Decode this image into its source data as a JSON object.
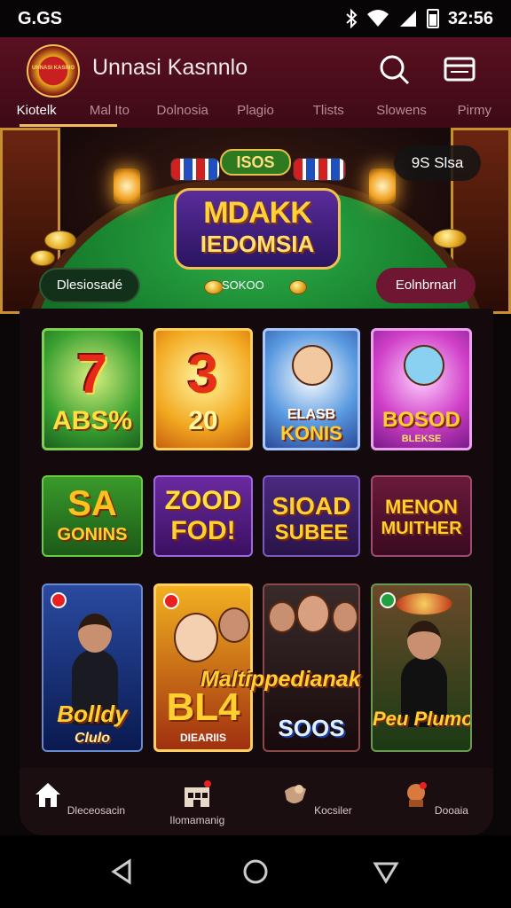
{
  "status": {
    "left": "G.GS",
    "time": "32:56"
  },
  "header": {
    "logo_text": "UNNASI KASINO",
    "title": "Unnasi Kasnnlo",
    "tabs": [
      {
        "label": "Kiotelk"
      },
      {
        "label": "Mal Ito"
      },
      {
        "label": "Dolnosia"
      },
      {
        "label": "Plagio"
      },
      {
        "label": "Tlists"
      },
      {
        "label": "Slowens"
      },
      {
        "label": "Pirmy"
      }
    ]
  },
  "hero": {
    "badge": "ISOS",
    "title_line1": "MDAKK",
    "title_line2": "IEDOMSIA",
    "top_pill": "9S Slsa",
    "left_pill": "Dlesiosadé",
    "right_pill": "Eolnbrnarl",
    "pot_label": "SOKOO"
  },
  "games": {
    "row1": [
      {
        "top": "7",
        "bottom": "ABS%"
      },
      {
        "top": "3",
        "bottom": "20"
      },
      {
        "top": "ELASB",
        "bottom": "KONIS"
      },
      {
        "top": "BOSOD",
        "bottom": "BLEKSE"
      }
    ],
    "row2": [
      {
        "top": "SA",
        "bottom": "GONINS"
      },
      {
        "top": "ZOOD",
        "bottom": "FOD!"
      },
      {
        "top": "SIOAD",
        "bottom": "SUBEE"
      },
      {
        "top": "MENON",
        "bottom": "MUITHER"
      }
    ],
    "row3": [
      {
        "top": "Bolldy",
        "bottom": "Clulo"
      },
      {
        "top": "BL4",
        "bottom": "DIEARIIS"
      },
      {
        "top": "",
        "bottom": "SOOS"
      },
      {
        "top": "",
        "bottom": "Peu Plumo"
      }
    ],
    "overlay": "Maltippedianak"
  },
  "bottom_nav": [
    {
      "label": "Dleceosacin"
    },
    {
      "label": "Ilomamanig"
    },
    {
      "label": "Kocsiler"
    },
    {
      "label": "Dooaia"
    }
  ],
  "colors": {
    "header": "#5a1020",
    "accent_gold": "#f0c060",
    "felt": "#17802e"
  }
}
